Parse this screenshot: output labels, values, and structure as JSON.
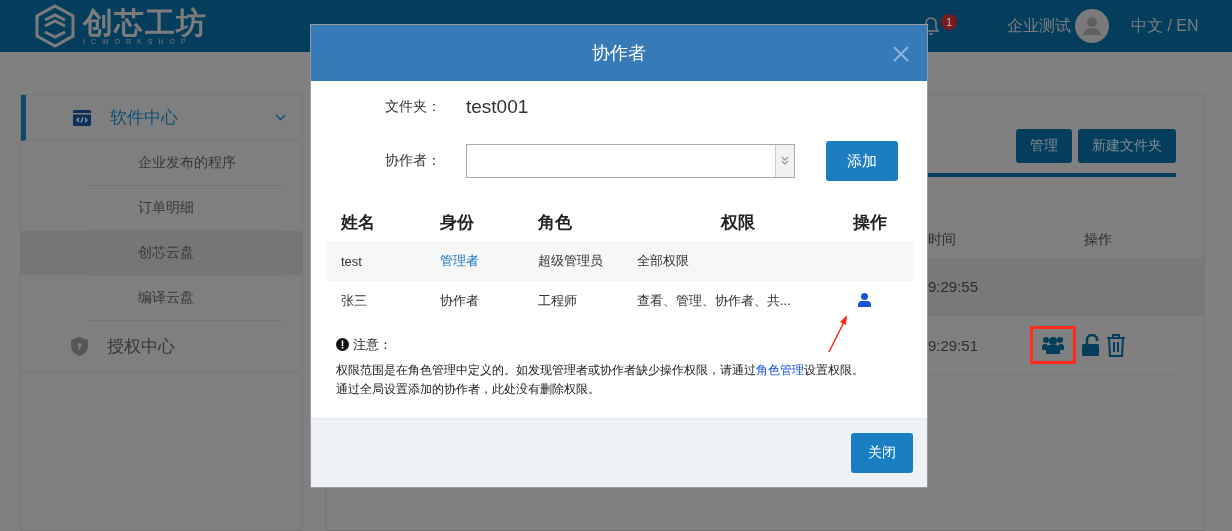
{
  "header": {
    "logo": {
      "name": "创芯工坊",
      "tagline": "ICWORKSHOP"
    },
    "notifications": {
      "count": "1"
    },
    "user": "企业测试",
    "language": "中文 / EN"
  },
  "sidebar": {
    "groups": [
      {
        "label": "软件中心",
        "kind": "software",
        "expanded": true,
        "selected": true,
        "children": [
          {
            "label": "企业发布的程序",
            "selected": false
          },
          {
            "label": "订单明细",
            "selected": false
          },
          {
            "label": "创芯云盘",
            "selected": true
          },
          {
            "label": "编译云盘",
            "selected": false
          }
        ]
      },
      {
        "label": "授权中心",
        "kind": "license",
        "expanded": false,
        "selected": false
      }
    ]
  },
  "content": {
    "buttons": [
      "管理",
      "新建文件夹"
    ],
    "columns": [
      "时间",
      "操作"
    ],
    "rows": [
      {
        "time": "9:29:55",
        "selected": true,
        "actions": false
      },
      {
        "time": "9:29:51",
        "selected": false,
        "actions": true
      }
    ]
  },
  "dialog": {
    "title": "协作者",
    "folder_label": "文件夹：",
    "folder": "test001",
    "collaborator_label": "协作者：",
    "add_button": "添加",
    "columns": [
      "姓名",
      "身份",
      "角色",
      "权限",
      "操作"
    ],
    "rows": [
      {
        "name": "test",
        "identity": "管理者",
        "identity_link": true,
        "role": "超级管理员",
        "permissions": "全部权限",
        "action": false
      },
      {
        "name": "张三",
        "identity": "协作者",
        "identity_link": false,
        "role": "工程师",
        "permissions": "查看、管理、协作者、共...",
        "action": true
      }
    ],
    "note_title": "注意：",
    "note_lines": [
      "权限范围是在角色管理中定义的。如发现管理者或协作者缺少操作权限，请通过",
      "角色管理",
      "设置权限。",
      "通过全局设置添加的协作者，此处没有删除权限。"
    ],
    "close_button": "关闭"
  }
}
